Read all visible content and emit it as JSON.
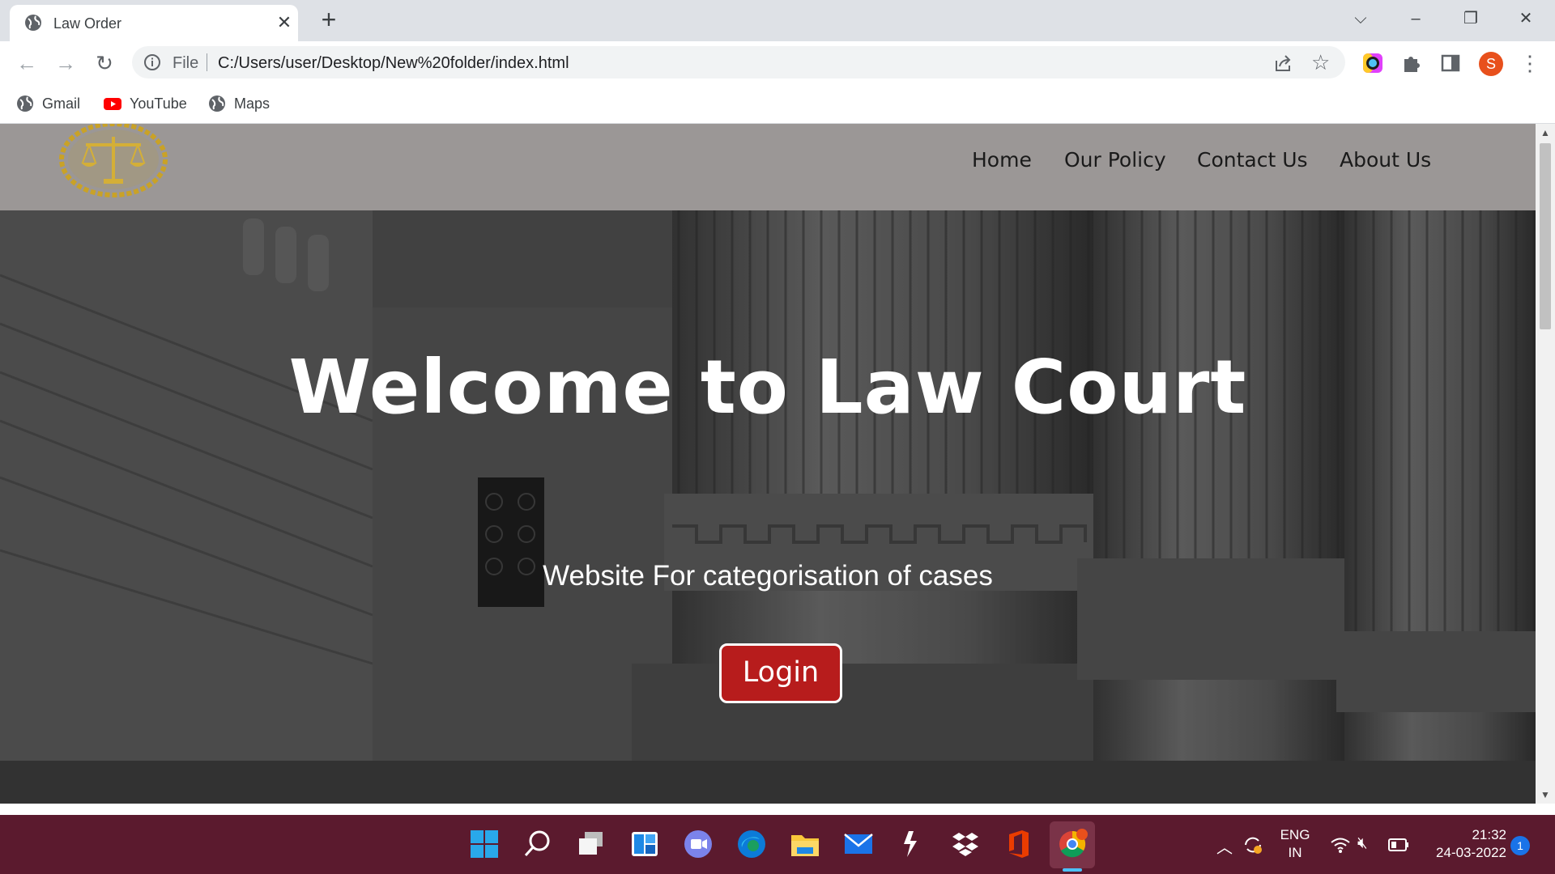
{
  "browser": {
    "tab_title": "Law Order",
    "address": {
      "scheme_label": "File",
      "url": "C:/Users/user/Desktop/New%20folder/index.html"
    },
    "profile_initial": "S",
    "bookmarks": [
      {
        "label": "Gmail",
        "icon": "globe-icon"
      },
      {
        "label": "YouTube",
        "icon": "youtube-icon"
      },
      {
        "label": "Maps",
        "icon": "globe-icon"
      }
    ]
  },
  "site": {
    "nav": [
      "Home",
      "Our Policy",
      "Contact Us",
      "About Us"
    ],
    "hero": {
      "title": "Welcome to Law Court",
      "subtitle": "Website For categorisation of cases",
      "login_label": "Login"
    },
    "colors": {
      "nav_bg": "#9b9796",
      "login_bg": "#b71c1c",
      "logo_gold": "#c9a227"
    }
  },
  "taskbar": {
    "language": "ENG",
    "region": "IN",
    "time": "21:32",
    "date": "24-03-2022",
    "notification_count": "1",
    "apps": [
      "start-icon",
      "search-icon",
      "task-view-icon",
      "widgets-icon",
      "teams-icon",
      "edge-icon",
      "file-explorer-icon",
      "mail-icon",
      "terminal-icon",
      "dropbox-icon",
      "office-icon",
      "chrome-icon"
    ]
  }
}
